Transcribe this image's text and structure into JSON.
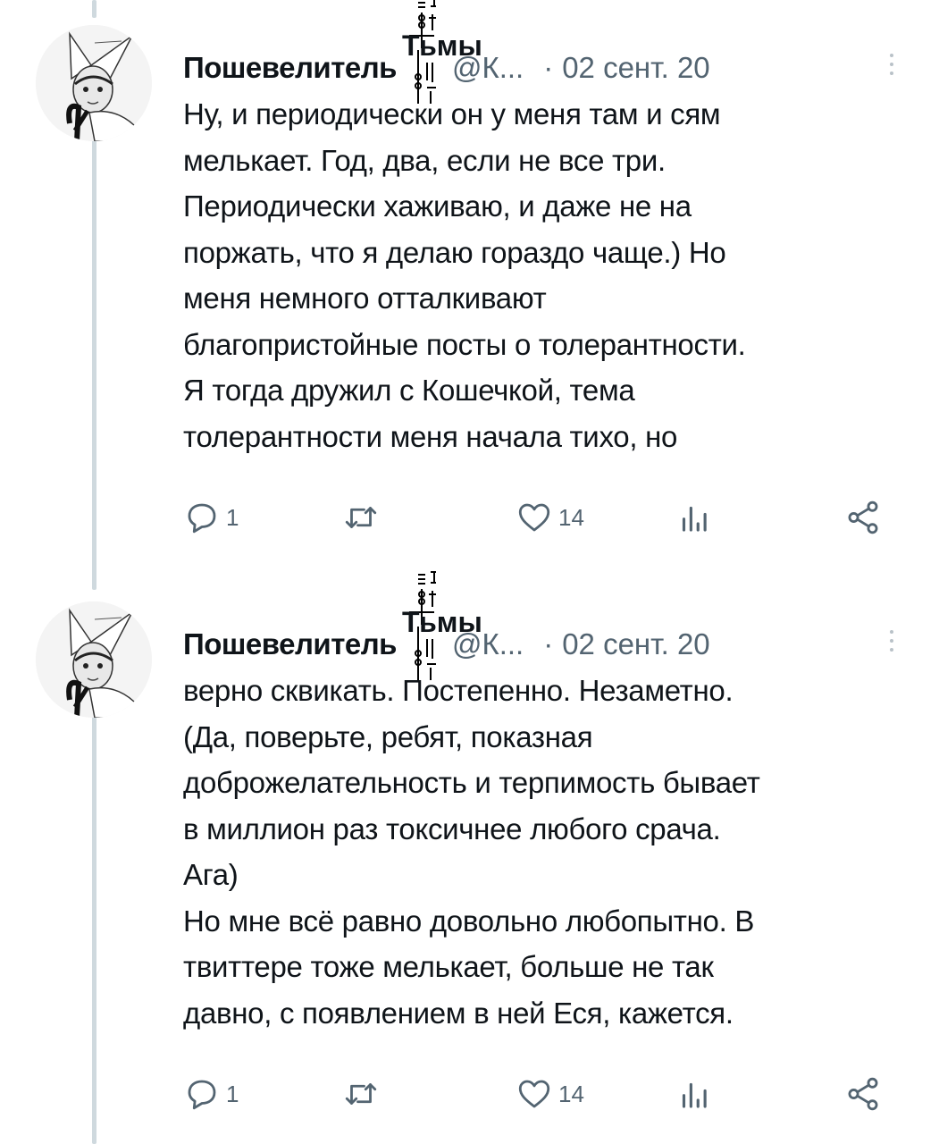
{
  "tweets": [
    {
      "author_name": "Пошевелитель",
      "name_glyph": "Тьмы",
      "handle": "@К...",
      "separator": "·",
      "date": "02 сент. 20",
      "lines": [
        "Ну, и периодически он у меня там и сям",
        "мелькает. Год, два, если не все три.",
        "Периодически хаживаю, и даже не на",
        "поржать, что я делаю гораздо чаще.) Но",
        "меня немного отталкивают",
        "благопристойные посты о толерантности.",
        "Я тогда дружил с Кошечкой, тема",
        "толерантности меня начала тихо, но"
      ],
      "reply_count": "1",
      "retweet_count": "",
      "like_count": "14",
      "views_count": ""
    },
    {
      "author_name": "Пошевелитель",
      "name_glyph": "Тьмы",
      "handle": "@К...",
      "separator": "·",
      "date": "02 сент. 20",
      "lines": [
        "верно сквикать. Постепенно. Незаметно.",
        "(Да, поверьте, ребят, показная",
        "доброжелательность и терпимость бывает",
        "в миллион раз токсичнее любого срача.",
        "Ага)",
        "Но мне всё равно довольно любопытно. В",
        "твиттере тоже мелькает, больше не так",
        "давно, с появлением в ней Еся, кажется."
      ],
      "reply_count": "1",
      "retweet_count": "",
      "like_count": "14",
      "views_count": ""
    }
  ],
  "icons": {
    "reply": "reply-icon",
    "retweet": "retweet-icon",
    "like": "heart-icon",
    "views": "views-icon",
    "share": "share-icon",
    "more": "more-options-icon"
  },
  "colors": {
    "text": "#0f1419",
    "secondary": "#536471",
    "thread_line": "#cfd9de"
  }
}
